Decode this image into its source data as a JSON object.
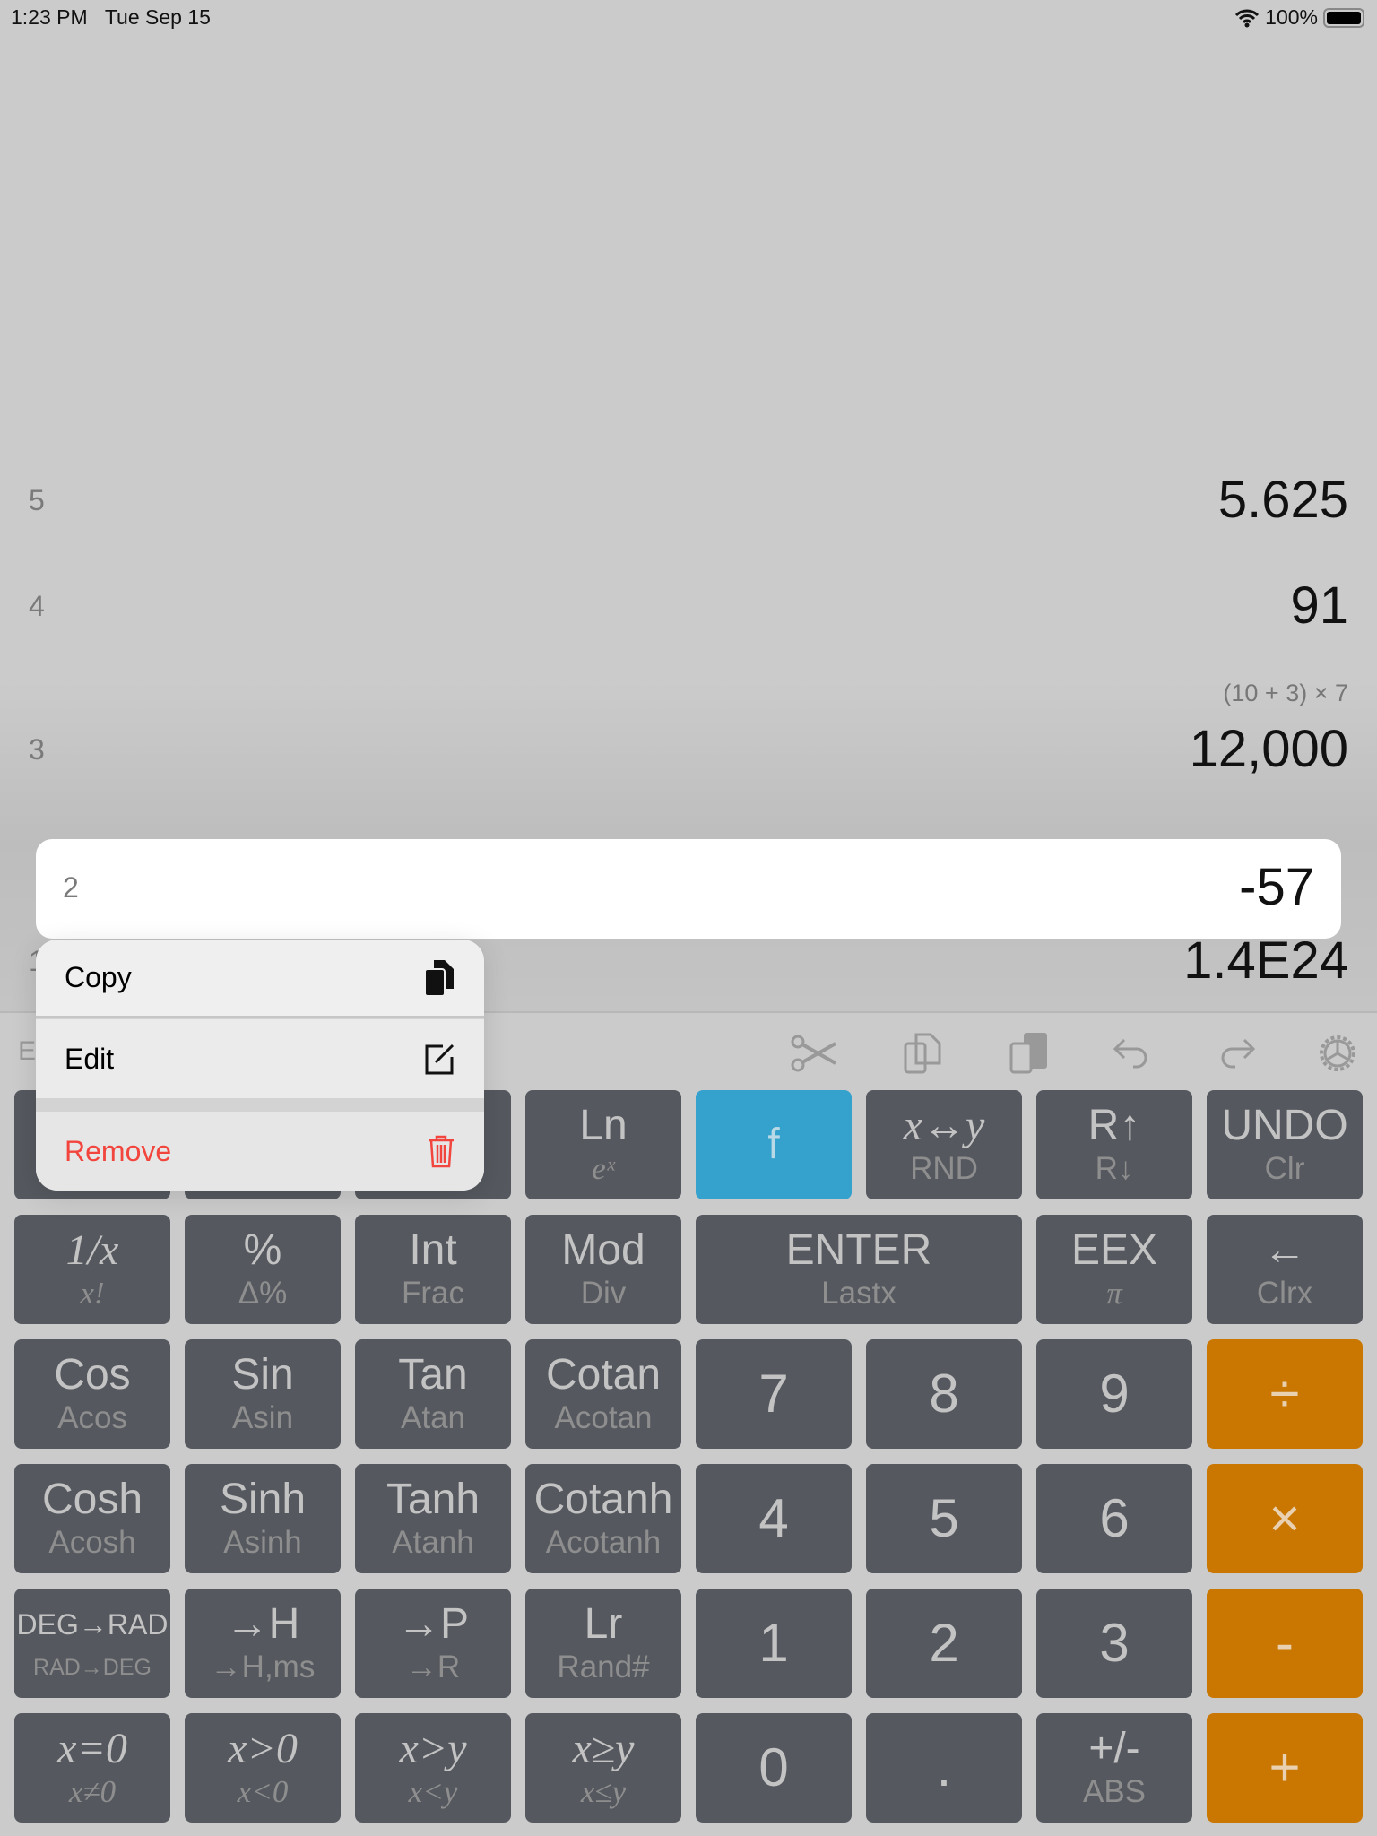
{
  "status": {
    "time": "1:23 PM",
    "date": "Tue Sep 15",
    "battery": "100%"
  },
  "stack": [
    {
      "index": "5",
      "value": "5.625"
    },
    {
      "index": "4",
      "value": "91",
      "expression": "(10 + 3) × 7"
    },
    {
      "index": "3",
      "value": "12,000"
    },
    {
      "index": "2",
      "value": "-57",
      "selected": true
    },
    {
      "index": "1",
      "value": "1.4E24"
    }
  ],
  "toolbar": {
    "left_label": "Edit",
    "icons": [
      "scissors-icon",
      "copy-icon",
      "paste-icon",
      "undo-icon",
      "redo-icon",
      "settings-gear-icon"
    ]
  },
  "menu": {
    "copy": "Copy",
    "edit": "Edit",
    "remove": "Remove",
    "remove_color": "#f2453d"
  },
  "colors": {
    "key": "#55595f",
    "orange": "#c97700",
    "blue": "#35a1cd"
  },
  "keys": [
    [
      {
        "m": "",
        "s": ""
      },
      {
        "m": "",
        "s": ""
      },
      {
        "m": "",
        "s": ""
      },
      {
        "m": "Ln",
        "s": "eˣ",
        "si": true
      },
      {
        "m": "f",
        "s": "",
        "style": "blue"
      },
      {
        "m": "x↔y",
        "s": "RND",
        "mi": true
      },
      {
        "m": "R↑",
        "s": "R↓"
      },
      {
        "m": "UNDO",
        "s": "Clr"
      }
    ],
    [
      {
        "m": "1/x",
        "s": "x!",
        "mi": true,
        "si": true
      },
      {
        "m": "%",
        "s": "Δ%"
      },
      {
        "m": "Int",
        "s": "Frac"
      },
      {
        "m": "Mod",
        "s": "Div"
      },
      {
        "m": "ENTER",
        "s": "Lastx",
        "span": 2
      },
      {
        "m": "EEX",
        "s": "π",
        "si": true
      },
      {
        "m": "←",
        "s": "Clrx"
      }
    ],
    [
      {
        "m": "Cos",
        "s": "Acos"
      },
      {
        "m": "Sin",
        "s": "Asin"
      },
      {
        "m": "Tan",
        "s": "Atan"
      },
      {
        "m": "Cotan",
        "s": "Acotan"
      },
      {
        "m": "7",
        "big": true
      },
      {
        "m": "8",
        "big": true
      },
      {
        "m": "9",
        "big": true
      },
      {
        "m": "÷",
        "big": true,
        "style": "orange"
      }
    ],
    [
      {
        "m": "Cosh",
        "s": "Acosh"
      },
      {
        "m": "Sinh",
        "s": "Asinh"
      },
      {
        "m": "Tanh",
        "s": "Atanh"
      },
      {
        "m": "Cotanh",
        "s": "Acotanh"
      },
      {
        "m": "4",
        "big": true
      },
      {
        "m": "5",
        "big": true
      },
      {
        "m": "6",
        "big": true
      },
      {
        "m": "×",
        "big": true,
        "style": "orange"
      }
    ],
    [
      {
        "m": "DEG→RAD",
        "s": "RAD→DEG",
        "small": true
      },
      {
        "m": "→H",
        "s": "→H,ms"
      },
      {
        "m": "→P",
        "s": "→R"
      },
      {
        "m": "Lr",
        "s": "Rand#"
      },
      {
        "m": "1",
        "big": true
      },
      {
        "m": "2",
        "big": true
      },
      {
        "m": "3",
        "big": true
      },
      {
        "m": "-",
        "big": true,
        "style": "orange"
      }
    ],
    [
      {
        "m": "x=0",
        "s": "x≠0",
        "mi": true,
        "si": true
      },
      {
        "m": "x>0",
        "s": "x<0",
        "mi": true,
        "si": true
      },
      {
        "m": "x>y",
        "s": "x<y",
        "mi": true,
        "si": true
      },
      {
        "m": "x≥y",
        "s": "x≤y",
        "mi": true,
        "si": true
      },
      {
        "m": "0",
        "big": true
      },
      {
        "m": ".",
        "big": true
      },
      {
        "m": "+/-",
        "s": "ABS"
      },
      {
        "m": "+",
        "big": true,
        "style": "orange"
      }
    ]
  ]
}
